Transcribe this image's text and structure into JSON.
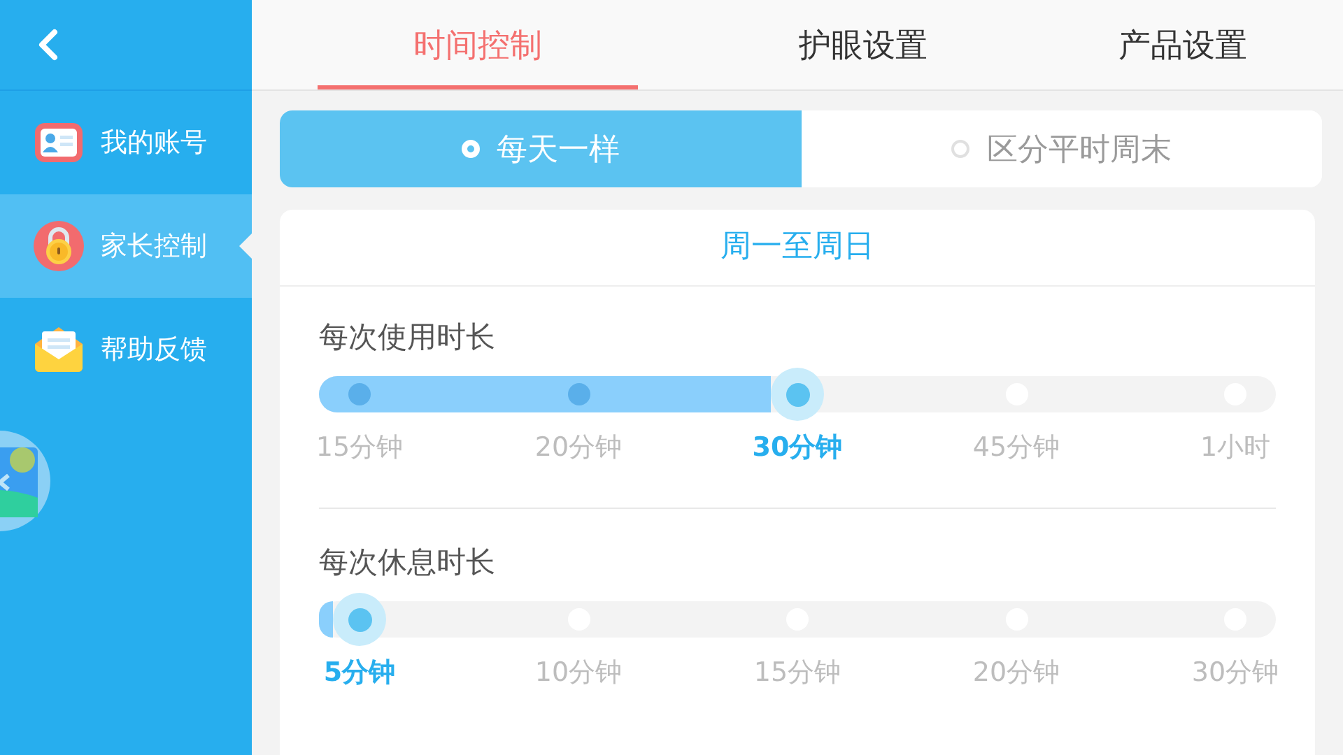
{
  "sidebar": {
    "items": [
      {
        "label": "我的账号",
        "kind": "account",
        "selected": false
      },
      {
        "label": "家长控制",
        "kind": "lock",
        "selected": true
      },
      {
        "label": "帮助反馈",
        "kind": "mail",
        "selected": false
      }
    ]
  },
  "tabs": [
    {
      "label": "时间控制",
      "selected": true
    },
    {
      "label": "护眼设置",
      "selected": false
    },
    {
      "label": "产品设置",
      "selected": false
    }
  ],
  "mode": [
    {
      "label": "每天一样",
      "selected": true
    },
    {
      "label": "区分平时周末",
      "selected": false
    }
  ],
  "card": {
    "title": "周一至周日",
    "sliders": [
      {
        "label": "每次使用时长",
        "options": [
          {
            "label": "15分钟",
            "selected": false
          },
          {
            "label": "20分钟",
            "selected": false
          },
          {
            "label": "30分钟",
            "selected": true
          },
          {
            "label": "45分钟",
            "selected": false
          },
          {
            "label": "1小时",
            "selected": false
          }
        ]
      },
      {
        "label": "每次休息时长",
        "options": [
          {
            "label": "5分钟",
            "selected": true
          },
          {
            "label": "10分钟",
            "selected": false
          },
          {
            "label": "15分钟",
            "selected": false
          },
          {
            "label": "20分钟",
            "selected": false
          },
          {
            "label": "30分钟",
            "selected": false
          }
        ]
      }
    ]
  }
}
